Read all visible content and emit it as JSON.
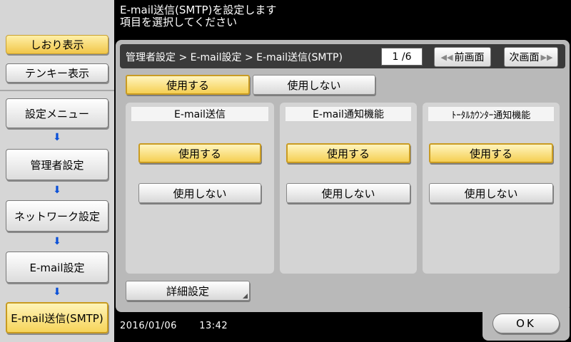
{
  "header": {
    "line1": "E-mail送信(SMTP)を設定します",
    "line2": "項目を選択してください"
  },
  "sidebar": {
    "bookmark_label": "しおり表示",
    "tenkey_label": "テンキー表示",
    "items": [
      {
        "label": "設定メニュー"
      },
      {
        "label": "管理者設定"
      },
      {
        "label": "ネットワーク設定"
      },
      {
        "label": "E-mail設定"
      },
      {
        "label": "E-mail送信(SMTP)"
      }
    ],
    "arrow_glyph": "⬇"
  },
  "breadcrumb": "管理者設定 > E-mail設定 > E-mail送信(SMTP)",
  "pager": {
    "page": "1 /6",
    "prev_label": "前画面",
    "next_label": "次画面",
    "prev_glyph": "◀◀",
    "next_glyph": "▶▶"
  },
  "global_toggle": {
    "on_label": "使用する",
    "off_label": "使用しない",
    "selected": "on"
  },
  "sections": [
    {
      "title": "E-mail送信",
      "on_label": "使用する",
      "off_label": "使用しない",
      "selected": "on"
    },
    {
      "title": "E-mail通知機能",
      "on_label": "使用する",
      "off_label": "使用しない",
      "selected": "on"
    },
    {
      "title": "ﾄｰﾀﾙｶｳﾝﾀｰ通知機能",
      "on_label": "使用する",
      "off_label": "使用しない",
      "selected": "on"
    }
  ],
  "detail_button": "詳細設定",
  "footer": {
    "date": "2016/01/06",
    "time": "13:42",
    "ok_label": "OK"
  },
  "colors": {
    "selected_gold": "#f5cf53",
    "arrow_blue": "#0a50d8",
    "panel_gray": "#b9b9b9"
  }
}
